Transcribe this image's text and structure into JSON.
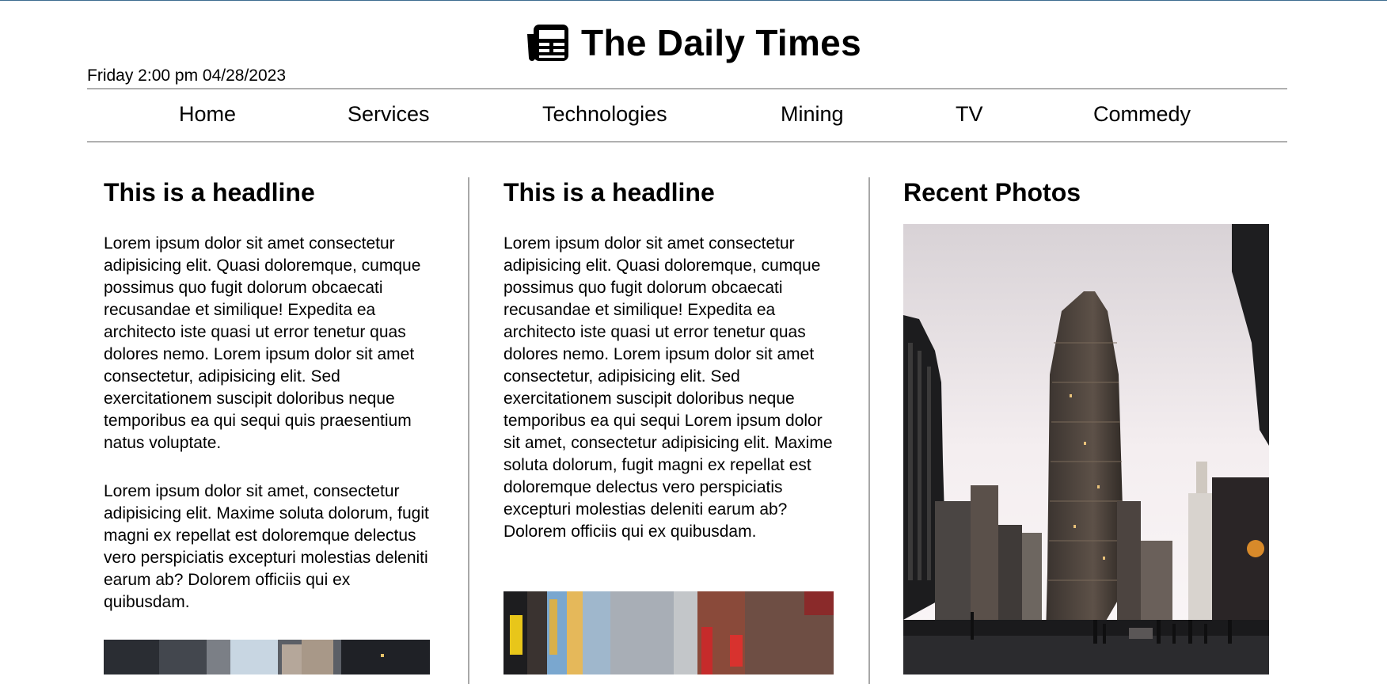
{
  "site": {
    "title": "The Daily Times",
    "logo_icon": "newspaper-icon",
    "dateline": "Friday 2:00 pm 04/28/2023"
  },
  "nav": {
    "items": [
      {
        "label": "Home"
      },
      {
        "label": "Services"
      },
      {
        "label": "Technologies"
      },
      {
        "label": "Mining"
      },
      {
        "label": "TV"
      },
      {
        "label": "Commedy"
      }
    ]
  },
  "columns": {
    "left": {
      "headline": "This is a headline",
      "paragraphs": [
        "Lorem ipsum dolor sit amet consectetur adipisicing elit. Quasi doloremque, cumque possimus quo fugit dolorum obcaecati recusandae et similique! Expedita ea architecto iste quasi ut error tenetur quas dolores nemo. Lorem ipsum dolor sit amet consectetur, adipisicing elit. Sed exercitationem suscipit doloribus neque temporibus ea qui sequi quis praesentium natus voluptate.",
        "Lorem ipsum dolor sit amet, consectetur adipisicing elit. Maxime soluta dolorum, fugit magni ex repellat est doloremque delectus vero perspiciatis excepturi molestias deleniti earum ab? Dolorem officiis qui ex quibusdam."
      ]
    },
    "middle": {
      "headline": "This is a headline",
      "paragraphs": [
        "Lorem ipsum dolor sit amet consectetur adipisicing elit. Quasi doloremque, cumque possimus quo fugit dolorum obcaecati recusandae et similique! Expedita ea architecto iste quasi ut error tenetur quas dolores nemo. Lorem ipsum dolor sit amet consectetur, adipisicing elit. Sed exercitationem suscipit doloribus neque temporibus ea qui sequi Lorem ipsum dolor sit amet, consectetur adipisicing elit. Maxime soluta dolorum, fugit magni ex repellat est doloremque delectus vero perspiciatis excepturi molestias deleniti earum ab? Dolorem officiis qui ex quibusdam."
      ]
    },
    "right": {
      "headline": "Recent Photos"
    }
  },
  "colors": {
    "top_rule": "#3d6d8f",
    "divider": "#b0b0b0",
    "text": "#000000"
  }
}
